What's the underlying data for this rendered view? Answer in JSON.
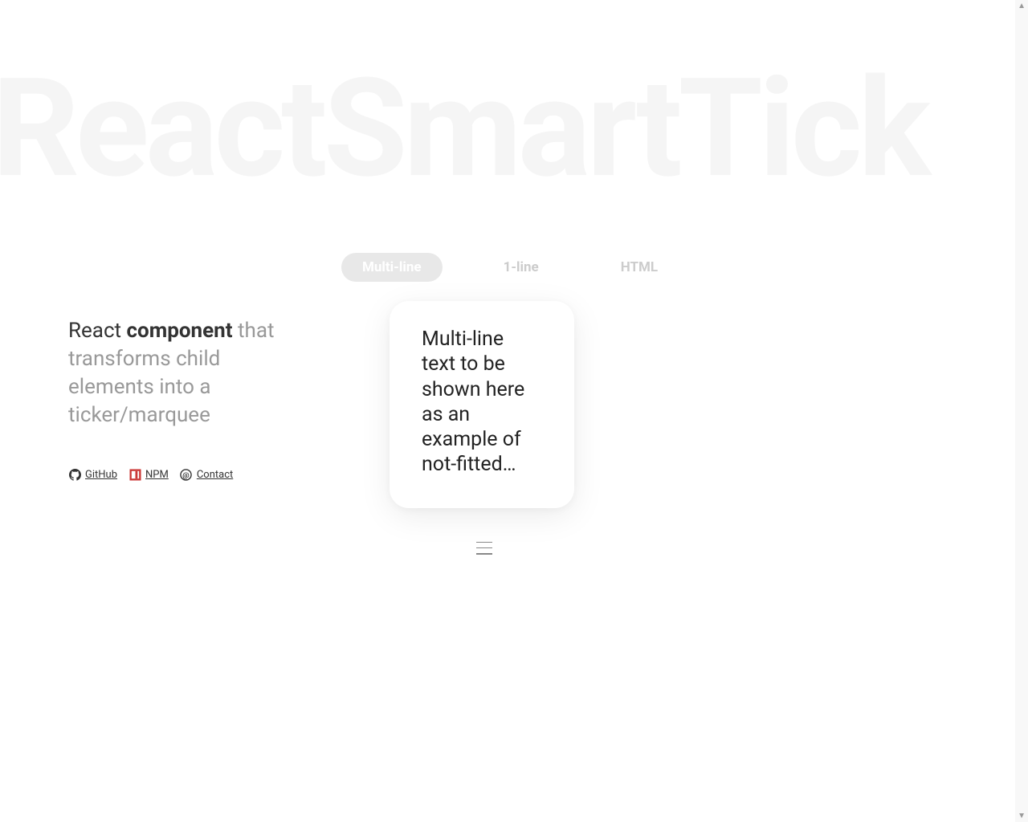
{
  "background_title": "ReactSmartTick",
  "description": {
    "prefix": "React ",
    "bold": "component",
    "rest": " that transforms child elements into a ticker/marquee"
  },
  "links": {
    "github": "GitHub",
    "npm": "NPM",
    "contact": "Contact"
  },
  "tabs": {
    "multi_line": "Multi-line",
    "one_line": "1-line",
    "html": "HTML"
  },
  "card_text": "Multi-line text to be shown here as an example of not-fitted…"
}
